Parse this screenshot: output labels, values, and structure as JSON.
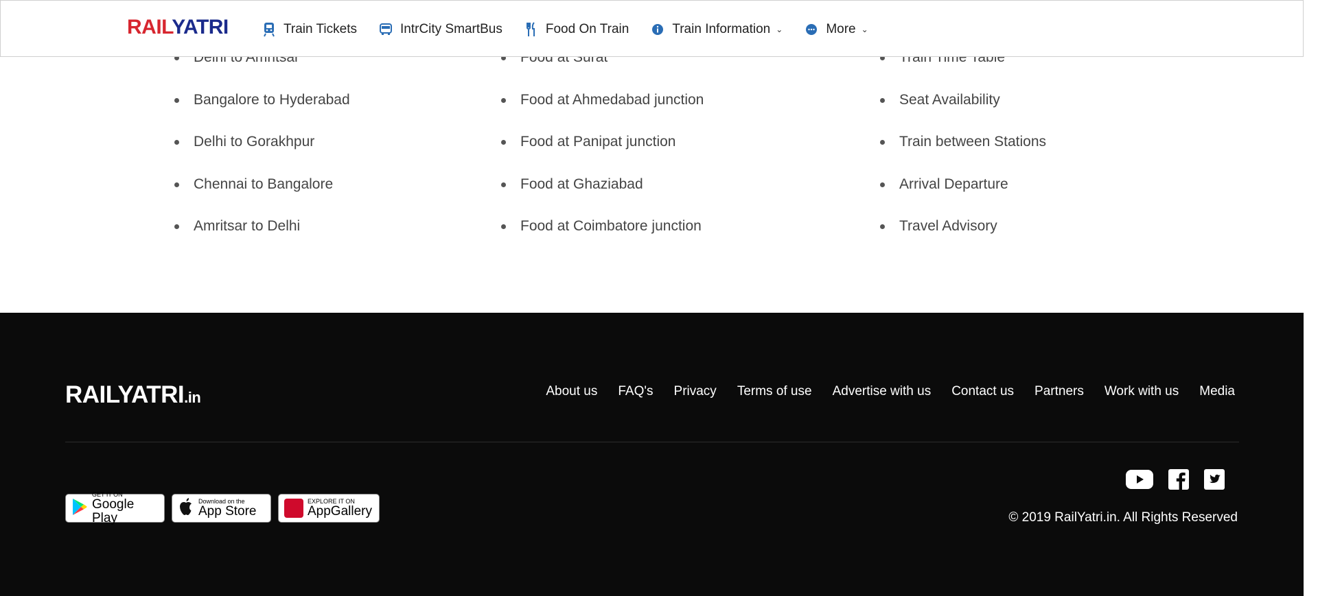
{
  "header": {
    "logo_rail": "RAIL",
    "logo_yatri": "YATRI",
    "nav": [
      {
        "label": "Train Tickets",
        "icon": "train-icon"
      },
      {
        "label": "IntrCity SmartBus",
        "icon": "bus-icon"
      },
      {
        "label": "Food On Train",
        "icon": "fork-icon"
      },
      {
        "label": "Train Information",
        "icon": "info-icon"
      },
      {
        "label": "More",
        "icon": "more-icon"
      }
    ]
  },
  "columns": {
    "routes": [
      "Delhi to Amritsar",
      "Bangalore to Hyderabad",
      "Delhi to Gorakhpur",
      "Chennai to Bangalore",
      "Amritsar to Delhi"
    ],
    "food": [
      "Food at Surat",
      "Food at Ahmedabad junction",
      "Food at Panipat junction",
      "Food at Ghaziabad",
      "Food at Coimbatore junction"
    ],
    "info": [
      "Train Time Table",
      "Seat Availability",
      "Train between Stations",
      "Arrival Departure",
      "Travel Advisory"
    ]
  },
  "footer": {
    "logo": "RAILYATRI",
    "logo_suffix": ".in",
    "links": [
      "About us",
      "FAQ's",
      "Privacy",
      "Terms of use",
      "Advertise with us",
      "Contact us",
      "Partners",
      "Work with us",
      "Media"
    ],
    "badges": {
      "google_small": "GET IT ON",
      "google_big": "Google Play",
      "apple_small": "Download on the",
      "apple_big": "App Store",
      "huawei_small": "EXPLORE IT ON",
      "huawei_big": "AppGallery"
    },
    "copyright": "© 2019 RailYatri.in. All Rights Reserved",
    "social": [
      "youtube-icon",
      "facebook-icon",
      "twitter-icon"
    ]
  },
  "colors": {
    "brand_red": "#d7262f",
    "brand_blue": "#1b2b8c",
    "footer_bg": "#0b0b0b"
  }
}
